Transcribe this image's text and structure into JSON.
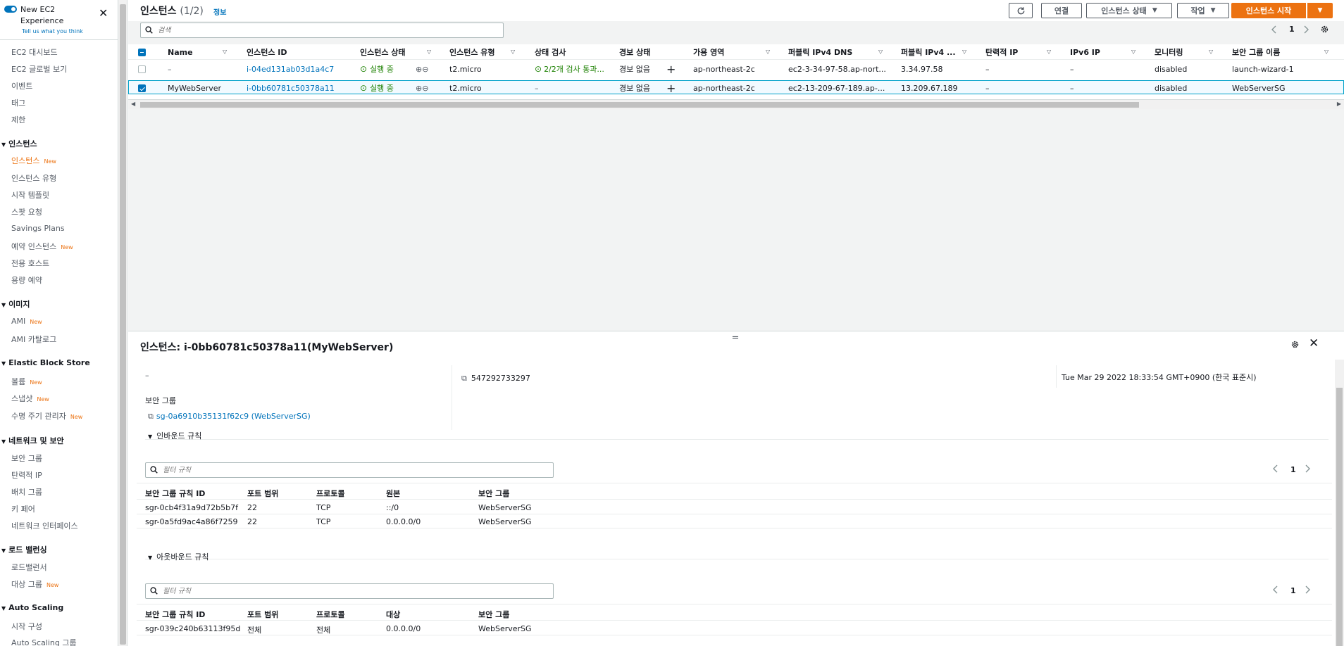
{
  "sidebar": {
    "new_experience": "New EC2 Experience",
    "tell_us": "Tell us what you think",
    "new_badge": "New",
    "items": [
      {
        "label": "EC2 대시보드"
      },
      {
        "label": "EC2 글로벌 보기"
      },
      {
        "label": "이벤트"
      },
      {
        "label": "태그"
      },
      {
        "label": "제한"
      }
    ],
    "sections": [
      {
        "title": "인스턴스",
        "items": [
          "인스턴스",
          "인스턴스 유형",
          "시작 템플릿",
          "스팟 요청",
          "Savings Plans",
          "예약 인스턴스",
          "전용 호스트",
          "용량 예약"
        ]
      },
      {
        "title": "이미지",
        "items": [
          "AMI",
          "AMI 카탈로그"
        ]
      },
      {
        "title": "Elastic Block Store",
        "items": [
          "볼륨",
          "스냅샷",
          "수명 주기 관리자"
        ]
      },
      {
        "title": "네트워크 및 보안",
        "items": [
          "보안 그룹",
          "탄력적 IP",
          "배치 그룹",
          "키 페어",
          "네트워크 인터페이스"
        ]
      },
      {
        "title": "로드 밸런싱",
        "items": [
          "로드밸런서",
          "대상 그룹"
        ]
      },
      {
        "title": "Auto Scaling",
        "items": [
          "시작 구성",
          "Auto Scaling 그룹"
        ]
      }
    ]
  },
  "header": {
    "title": "인스턴스",
    "count": "(1/2)",
    "info": "정보",
    "connect": "연결",
    "state": "인스턴스 상태",
    "actions": "작업",
    "launch": "인스턴스 시작",
    "search_placeholder": "검색",
    "page": "1"
  },
  "table": {
    "columns": [
      "Name",
      "인스턴스 ID",
      "인스턴스 상태",
      "인스턴스 유형",
      "상태 검사",
      "경보 상태",
      "가용 영역",
      "퍼블릭 IPv4 DNS",
      "퍼블릭 IPv4 ...",
      "탄력적 IP",
      "IPv6 IP",
      "모니터링",
      "보안 그룹 이름"
    ],
    "rows": [
      {
        "name": "–",
        "id": "i-04ed131ab03d1a4c7",
        "state": "실행 중",
        "type": "t2.micro",
        "check": "2/2개 검사 통과...",
        "alarm": "경보 없음",
        "az": "ap-northeast-2c",
        "dns": "ec2-3-34-97-58.ap-nort...",
        "ipv4": "3.34.97.58",
        "eip": "–",
        "ipv6": "–",
        "mon": "disabled",
        "sg": "launch-wizard-1"
      },
      {
        "name": "MyWebServer",
        "id": "i-0bb60781c50378a11",
        "state": "실행 중",
        "type": "t2.micro",
        "check": "–",
        "alarm": "경보 없음",
        "az": "ap-northeast-2c",
        "dns": "ec2-13-209-67-189.ap-...",
        "ipv4": "13.209.67.189",
        "eip": "–",
        "ipv6": "–",
        "mon": "disabled",
        "sg": "WebServerSG"
      }
    ]
  },
  "detail": {
    "title": "인스턴스: i-0bb60781c50378a11(MyWebServer)",
    "dash": "–",
    "owner": "547292733297",
    "launch_time": "Tue Mar 29 2022 18:33:54 GMT+0900 (한국 표준시)",
    "sg_label": "보안 그룹",
    "sg_link": "sg-0a6910b35131f62c9 (WebServerSG)",
    "inbound_title": "인바운드 규칙",
    "outbound_title": "아웃바운드 규칙",
    "filter_placeholder": "필터 규칙",
    "page": "1",
    "inbound_columns": [
      "보안 그룹 규칙 ID",
      "포트 범위",
      "프로토콜",
      "원본",
      "보안 그룹"
    ],
    "inbound_rows": [
      [
        "sgr-0cb4f31a9d72b5b7f",
        "22",
        "TCP",
        "::/0",
        "WebServerSG"
      ],
      [
        "sgr-0a5fd9ac4a86f7259",
        "22",
        "TCP",
        "0.0.0.0/0",
        "WebServerSG"
      ]
    ],
    "outbound_columns": [
      "보안 그룹 규칙 ID",
      "포트 범위",
      "프로토콜",
      "대상",
      "보안 그룹"
    ],
    "outbound_rows": [
      [
        "sgr-039c240b63113f95d",
        "전체",
        "전체",
        "0.0.0.0/0",
        "WebServerSG"
      ]
    ]
  }
}
